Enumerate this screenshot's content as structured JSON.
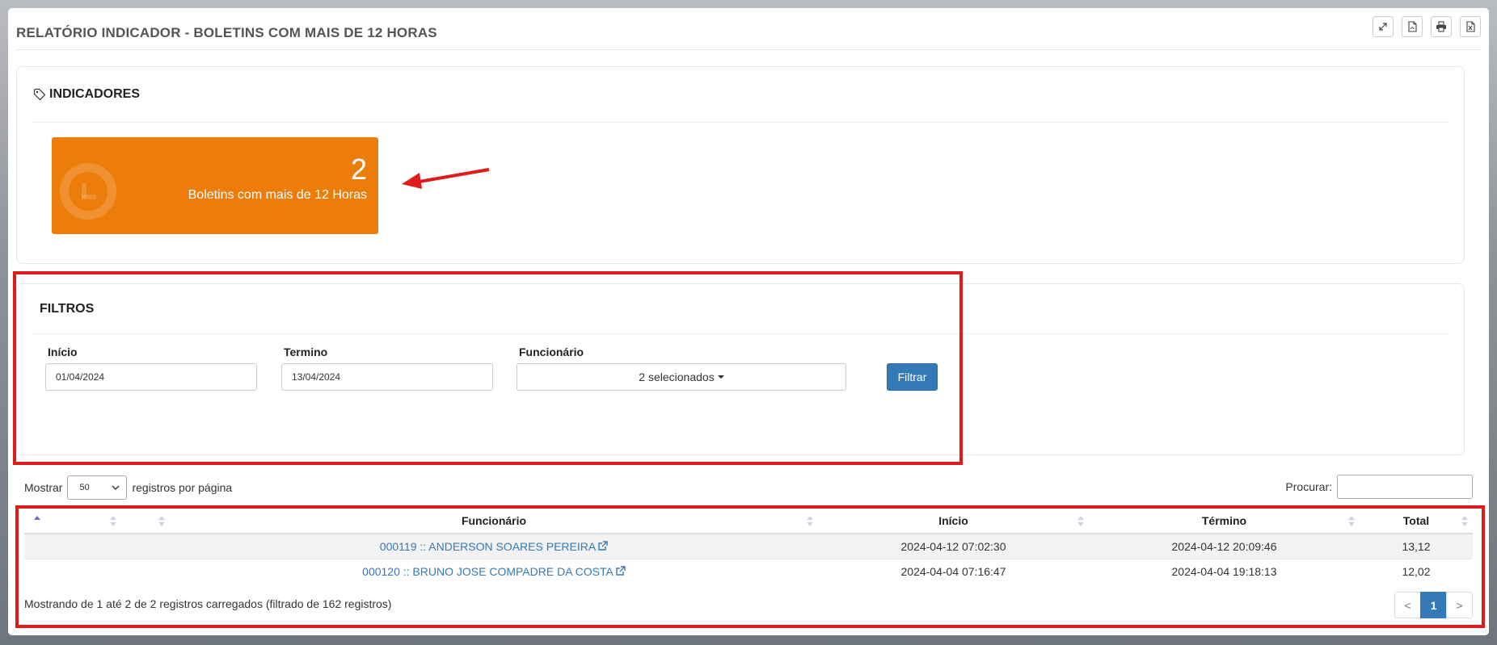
{
  "page_title": "RELATÓRIO INDICADOR - BOLETINS COM MAIS DE 12 HORAS",
  "toolbar": {
    "icons": [
      "expand-icon",
      "pdf-icon",
      "print-icon",
      "excel-icon"
    ]
  },
  "indicators": {
    "title": "INDICADORES",
    "box": {
      "value": "2",
      "label": "Boletins com mais de 12 Horas",
      "color": "#ec7d0a"
    }
  },
  "filters": {
    "title": "FILTROS",
    "inicio_label": "Início",
    "inicio_value": "01/04/2024",
    "termino_label": "Termino",
    "termino_value": "13/04/2024",
    "funcionario_label": "Funcionário",
    "funcionario_value": "2 selecionados",
    "filter_button": "Filtrar"
  },
  "table_controls": {
    "show_label": "Mostrar",
    "page_size": "50",
    "per_page_label": "registros por página",
    "search_label": "Procurar:"
  },
  "table": {
    "columns": [
      "",
      "",
      "",
      "Funcionário",
      "Início",
      "Término",
      "Total"
    ],
    "rows": [
      {
        "funcionario": "000119 :: ANDERSON SOARES PEREIRA",
        "inicio": "2024-04-12 07:02:30",
        "termino": "2024-04-12 20:09:46",
        "total": "13,12"
      },
      {
        "funcionario": "000120 :: BRUNO JOSE COMPADRE DA COSTA",
        "inicio": "2024-04-04 07:16:47",
        "termino": "2024-04-04 19:18:13",
        "total": "12,02"
      }
    ]
  },
  "footer": {
    "info": "Mostrando de 1 até 2 de 2 registros carregados (filtrado de 162 registros)",
    "pagination": {
      "prev": "<",
      "current": "1",
      "next": ">"
    }
  },
  "colors": {
    "accent": "#337ab7",
    "highlight": "#e01b1b",
    "indicator": "#ec7d0a"
  }
}
